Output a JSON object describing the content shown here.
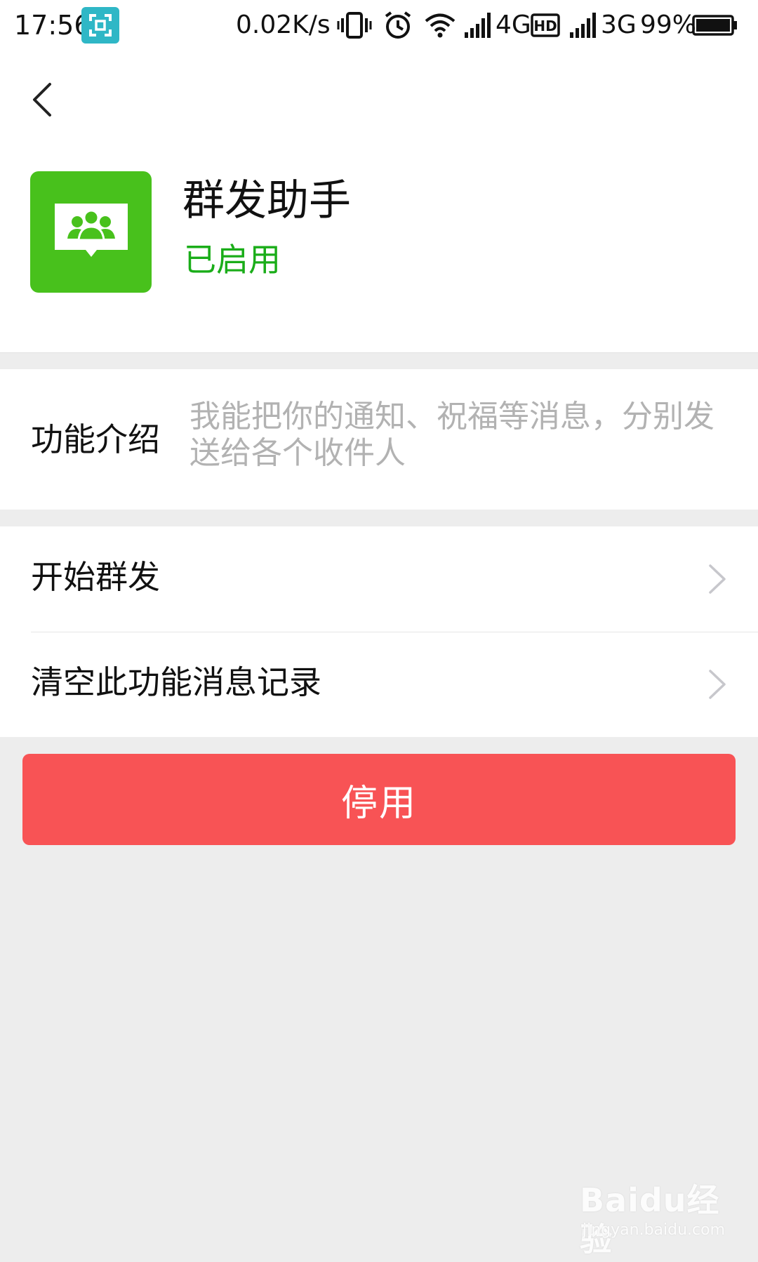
{
  "status_bar": {
    "time": "17:56",
    "net_speed": "0.02K/s",
    "network_4g": "4G",
    "network_3g": "3G",
    "battery_percent": "99%",
    "icons": [
      "screenshot-icon",
      "vibrate-icon",
      "alarm-icon",
      "wifi-icon",
      "signal-icon",
      "hd-icon",
      "signal-icon",
      "battery-icon"
    ]
  },
  "header": {
    "back_icon": "chevron-left-icon"
  },
  "app": {
    "name": "群发助手",
    "status": "已启用",
    "icon": "group-message-icon",
    "status_color": "#1aad19",
    "icon_color": "#48c11c"
  },
  "intro": {
    "label": "功能介绍",
    "text": "我能把你的通知、祝福等消息，分别发送给各个收件人"
  },
  "menu": {
    "items": [
      {
        "label": "开始群发"
      },
      {
        "label": "清空此功能消息记录"
      }
    ]
  },
  "actions": {
    "disable_label": "停用",
    "disable_color": "#f85355"
  },
  "watermark": {
    "logo": "Baidu经验",
    "url": "jingyan.baidu.com"
  }
}
